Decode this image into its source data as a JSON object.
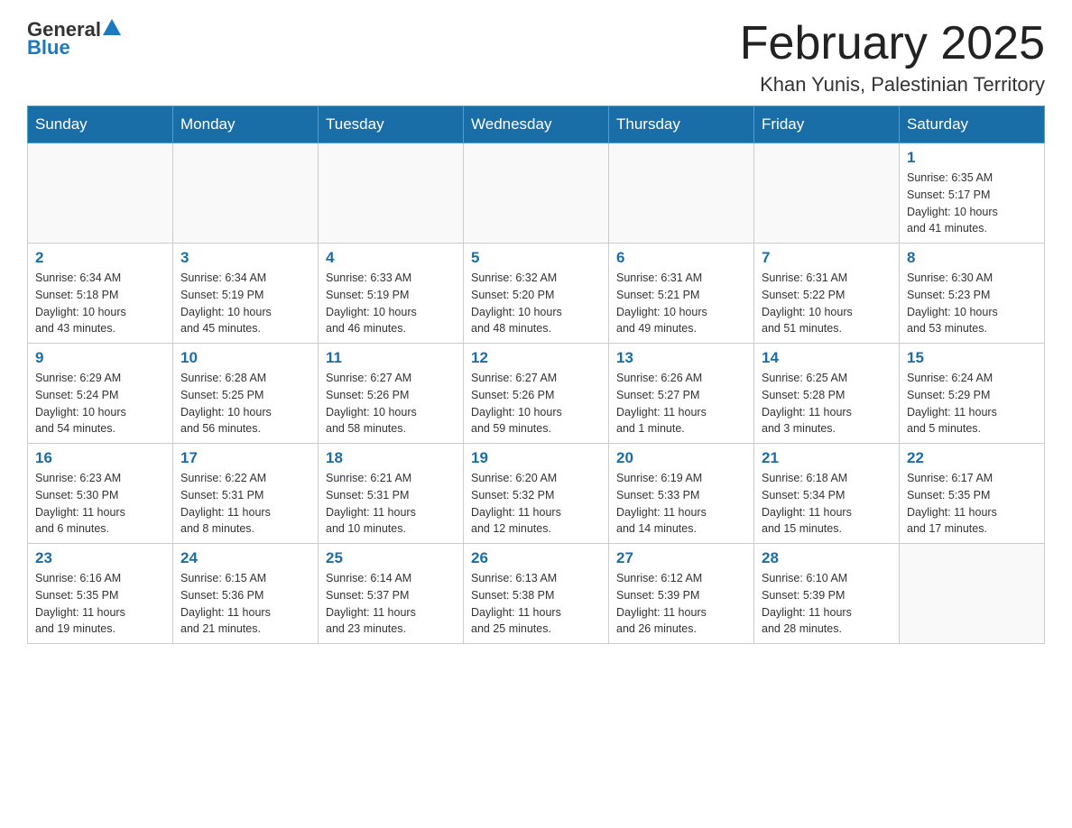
{
  "header": {
    "logo": {
      "general": "General",
      "blue": "Blue"
    },
    "title": "February 2025",
    "location": "Khan Yunis, Palestinian Territory"
  },
  "weekdays": [
    "Sunday",
    "Monday",
    "Tuesday",
    "Wednesday",
    "Thursday",
    "Friday",
    "Saturday"
  ],
  "weeks": [
    [
      {
        "day": "",
        "info": ""
      },
      {
        "day": "",
        "info": ""
      },
      {
        "day": "",
        "info": ""
      },
      {
        "day": "",
        "info": ""
      },
      {
        "day": "",
        "info": ""
      },
      {
        "day": "",
        "info": ""
      },
      {
        "day": "1",
        "info": "Sunrise: 6:35 AM\nSunset: 5:17 PM\nDaylight: 10 hours\nand 41 minutes."
      }
    ],
    [
      {
        "day": "2",
        "info": "Sunrise: 6:34 AM\nSunset: 5:18 PM\nDaylight: 10 hours\nand 43 minutes."
      },
      {
        "day": "3",
        "info": "Sunrise: 6:34 AM\nSunset: 5:19 PM\nDaylight: 10 hours\nand 45 minutes."
      },
      {
        "day": "4",
        "info": "Sunrise: 6:33 AM\nSunset: 5:19 PM\nDaylight: 10 hours\nand 46 minutes."
      },
      {
        "day": "5",
        "info": "Sunrise: 6:32 AM\nSunset: 5:20 PM\nDaylight: 10 hours\nand 48 minutes."
      },
      {
        "day": "6",
        "info": "Sunrise: 6:31 AM\nSunset: 5:21 PM\nDaylight: 10 hours\nand 49 minutes."
      },
      {
        "day": "7",
        "info": "Sunrise: 6:31 AM\nSunset: 5:22 PM\nDaylight: 10 hours\nand 51 minutes."
      },
      {
        "day": "8",
        "info": "Sunrise: 6:30 AM\nSunset: 5:23 PM\nDaylight: 10 hours\nand 53 minutes."
      }
    ],
    [
      {
        "day": "9",
        "info": "Sunrise: 6:29 AM\nSunset: 5:24 PM\nDaylight: 10 hours\nand 54 minutes."
      },
      {
        "day": "10",
        "info": "Sunrise: 6:28 AM\nSunset: 5:25 PM\nDaylight: 10 hours\nand 56 minutes."
      },
      {
        "day": "11",
        "info": "Sunrise: 6:27 AM\nSunset: 5:26 PM\nDaylight: 10 hours\nand 58 minutes."
      },
      {
        "day": "12",
        "info": "Sunrise: 6:27 AM\nSunset: 5:26 PM\nDaylight: 10 hours\nand 59 minutes."
      },
      {
        "day": "13",
        "info": "Sunrise: 6:26 AM\nSunset: 5:27 PM\nDaylight: 11 hours\nand 1 minute."
      },
      {
        "day": "14",
        "info": "Sunrise: 6:25 AM\nSunset: 5:28 PM\nDaylight: 11 hours\nand 3 minutes."
      },
      {
        "day": "15",
        "info": "Sunrise: 6:24 AM\nSunset: 5:29 PM\nDaylight: 11 hours\nand 5 minutes."
      }
    ],
    [
      {
        "day": "16",
        "info": "Sunrise: 6:23 AM\nSunset: 5:30 PM\nDaylight: 11 hours\nand 6 minutes."
      },
      {
        "day": "17",
        "info": "Sunrise: 6:22 AM\nSunset: 5:31 PM\nDaylight: 11 hours\nand 8 minutes."
      },
      {
        "day": "18",
        "info": "Sunrise: 6:21 AM\nSunset: 5:31 PM\nDaylight: 11 hours\nand 10 minutes."
      },
      {
        "day": "19",
        "info": "Sunrise: 6:20 AM\nSunset: 5:32 PM\nDaylight: 11 hours\nand 12 minutes."
      },
      {
        "day": "20",
        "info": "Sunrise: 6:19 AM\nSunset: 5:33 PM\nDaylight: 11 hours\nand 14 minutes."
      },
      {
        "day": "21",
        "info": "Sunrise: 6:18 AM\nSunset: 5:34 PM\nDaylight: 11 hours\nand 15 minutes."
      },
      {
        "day": "22",
        "info": "Sunrise: 6:17 AM\nSunset: 5:35 PM\nDaylight: 11 hours\nand 17 minutes."
      }
    ],
    [
      {
        "day": "23",
        "info": "Sunrise: 6:16 AM\nSunset: 5:35 PM\nDaylight: 11 hours\nand 19 minutes."
      },
      {
        "day": "24",
        "info": "Sunrise: 6:15 AM\nSunset: 5:36 PM\nDaylight: 11 hours\nand 21 minutes."
      },
      {
        "day": "25",
        "info": "Sunrise: 6:14 AM\nSunset: 5:37 PM\nDaylight: 11 hours\nand 23 minutes."
      },
      {
        "day": "26",
        "info": "Sunrise: 6:13 AM\nSunset: 5:38 PM\nDaylight: 11 hours\nand 25 minutes."
      },
      {
        "day": "27",
        "info": "Sunrise: 6:12 AM\nSunset: 5:39 PM\nDaylight: 11 hours\nand 26 minutes."
      },
      {
        "day": "28",
        "info": "Sunrise: 6:10 AM\nSunset: 5:39 PM\nDaylight: 11 hours\nand 28 minutes."
      },
      {
        "day": "",
        "info": ""
      }
    ]
  ]
}
